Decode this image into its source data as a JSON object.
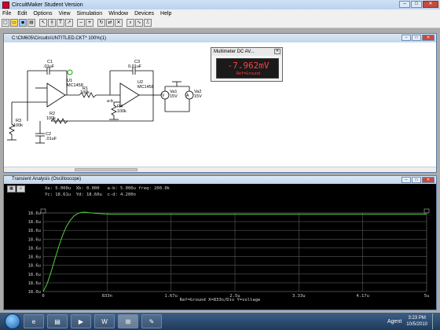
{
  "app": {
    "title": "CircuitMaker Student Version"
  },
  "window_controls": {
    "minimize": "–",
    "maximize": "□",
    "close": "✕"
  },
  "menu": [
    "File",
    "Edit",
    "Options",
    "View",
    "Simulation",
    "Window",
    "Devices",
    "Help"
  ],
  "toolbar_icons": [
    "new-icon",
    "open-icon",
    "save-icon",
    "print-icon",
    "arrow-tool-icon",
    "wire-tool-icon",
    "text-tool-icon",
    "probe-tool-icon",
    "zoom-out-icon",
    "zoom-in-icon",
    "rotate-icon",
    "mirror-icon",
    "delete-icon",
    "search-icon",
    "waveform-icon",
    "digital-sim-icon"
  ],
  "circuit_window": {
    "title": "C:\\CM605\\Circuits\\UNTITLED.CKT* 100%(1)",
    "components": {
      "c1": {
        "name": "C1",
        "value": ".01uF"
      },
      "c3": {
        "name": "C3",
        "value": "0.01uF"
      },
      "u1": {
        "name": "U1",
        "part": "MC1458"
      },
      "u2": {
        "name": "U2",
        "part": "MC1458"
      },
      "r1": {
        "name": "R1",
        "value": "100k"
      },
      "r3": {
        "name": "R3",
        "value": "100k"
      },
      "r2": {
        "name": "R2",
        "value": "100k"
      },
      "r4": {
        "name": "R4",
        "value": "100k"
      },
      "c2": {
        "name": "C2",
        "value": ".01uF"
      },
      "va1": {
        "name": "Va1",
        "value": "15V"
      },
      "va2": {
        "name": "Va2",
        "value": "15V"
      },
      "ground_label": "a-b"
    }
  },
  "multimeter": {
    "title": "Multimeter DC AV...",
    "reading": "-7.962mV",
    "reference": "Ref=Ground"
  },
  "scope_window": {
    "title": "Transient Analysis (Oscilloscope)",
    "readout": {
      "line1": "Xa: 5.000u  Xb: 0.000   a-b: 5.000u freq: 200.0k",
      "line2": "Yc: 18.61u  Yd: 18.60u  c-d: 4.200n"
    },
    "footer": "Ref=Ground  X=833n/Div Y=voltage",
    "trace_color": "#4cd43a"
  },
  "chart_data": {
    "type": "line",
    "title": "",
    "xlabel": "",
    "ylabel": "",
    "x_ticks": [
      "0",
      "833n",
      "1.67u",
      "2.5u",
      "3.33u",
      "4.17u",
      "5u"
    ],
    "y_ticks": [
      "18.6u",
      "18.6u",
      "18.6u",
      "18.6u",
      "18.6u",
      "18.6u",
      "18.6u",
      "18.6u",
      "18.6u",
      "18.0u"
    ],
    "xlim": [
      0,
      5.0
    ],
    "ylim": [
      18.0,
      18.62
    ],
    "series": [
      {
        "x": [
          0,
          0.05,
          0.1,
          0.15,
          0.2,
          0.25,
          0.3,
          0.35,
          0.4,
          0.45,
          0.5,
          0.55,
          0.6,
          0.7,
          0.8,
          0.9,
          1.0,
          1.2,
          1.5,
          2.0,
          2.5,
          3.0,
          3.5,
          4.0,
          4.5,
          5.0
        ],
        "y": [
          18.0,
          18.06,
          18.15,
          18.25,
          18.35,
          18.44,
          18.51,
          18.56,
          18.595,
          18.615,
          18.625,
          18.626,
          18.622,
          18.616,
          18.612,
          18.61,
          18.61,
          18.61,
          18.61,
          18.61,
          18.61,
          18.61,
          18.61,
          18.61,
          18.61,
          18.61
        ]
      }
    ]
  },
  "taskbar": {
    "apps": [
      "internet-explorer-icon",
      "file-explorer-icon",
      "media-player-icon",
      "word-icon",
      "circuitmaker-icon",
      "paint-icon"
    ],
    "tray_label": "Agent",
    "time": "3:23 PM",
    "date": "10/5/2010"
  }
}
